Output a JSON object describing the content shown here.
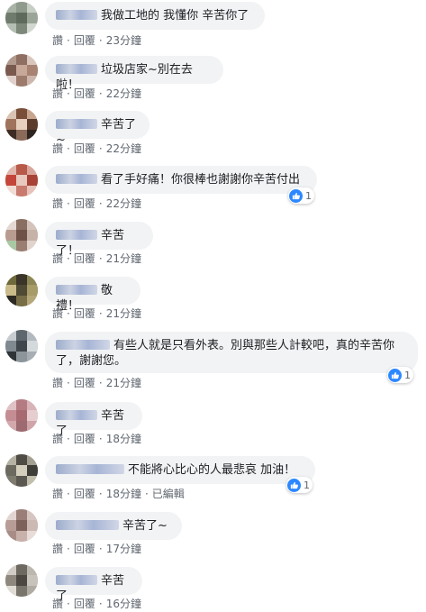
{
  "actions": {
    "like": "讚",
    "reply": "回覆",
    "edited": "已編輯"
  },
  "comments": [
    {
      "text": "我做工地的 我懂你 辛苦你了",
      "time": "23分鐘"
    },
    {
      "text": "垃圾店家~別在去啦！",
      "time": "22分鐘"
    },
    {
      "text": "辛苦了~",
      "time": "22分鐘"
    },
    {
      "text": "看了手好痛！你很棒也謝謝你辛苦付出",
      "time": "22分鐘",
      "likes": "1"
    },
    {
      "text": "辛苦了！",
      "time": "21分鐘"
    },
    {
      "text": "敬禮！",
      "time": "21分鐘"
    },
    {
      "text": "有些人就是只看外表。別與那些人計較吧，真的辛苦你了，謝謝您。",
      "time": "21分鐘",
      "likes": "1"
    },
    {
      "text": "辛苦了",
      "time": "18分鐘"
    },
    {
      "text": "不能將心比心的人最悲哀 加油！",
      "time": "18分鐘",
      "likes": "1"
    },
    {
      "text": "辛苦了~",
      "time": "17分鐘"
    },
    {
      "text": "辛苦了",
      "time": "16分鐘"
    }
  ]
}
